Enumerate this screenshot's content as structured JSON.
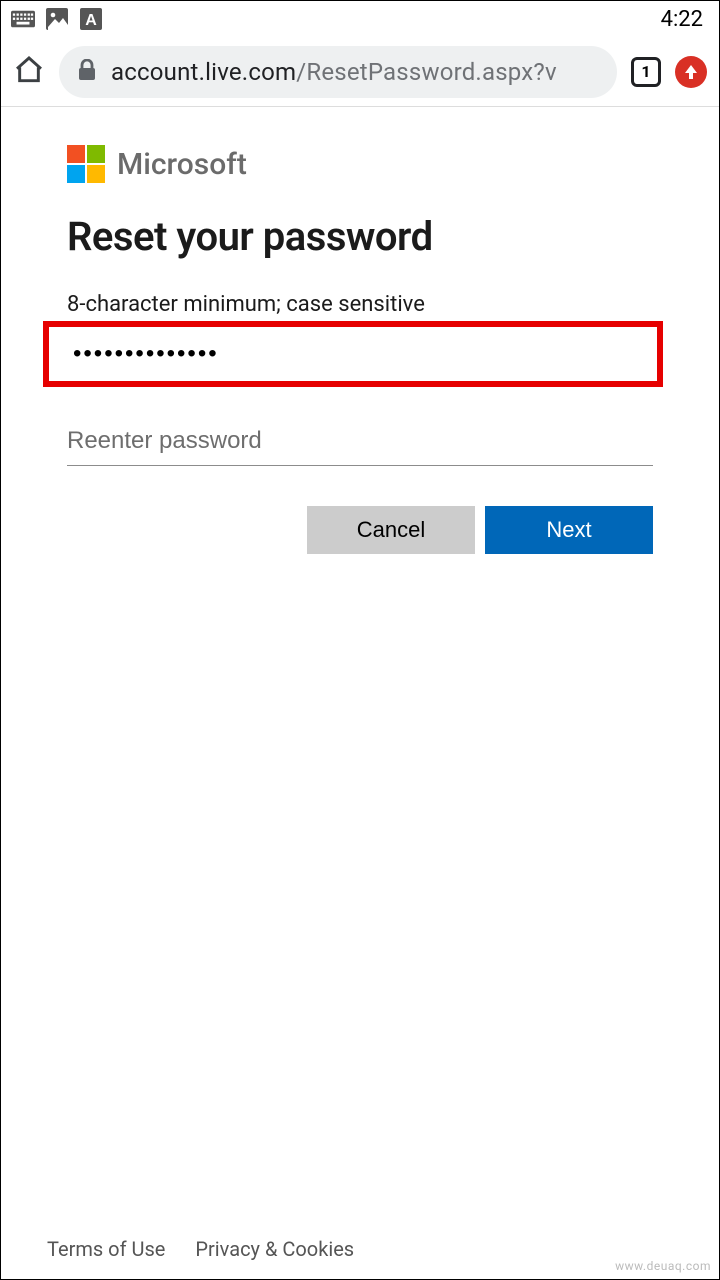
{
  "status_bar": {
    "time": "4:22"
  },
  "browser": {
    "tab_count": "1",
    "address_domain": "account.live.com",
    "address_path": "/ResetPassword.aspx?v"
  },
  "header": {
    "brand": "Microsoft"
  },
  "main": {
    "title": "Reset your password",
    "hint": "8-character minimum; case sensitive",
    "password_value": "••••••••••••••",
    "reenter_placeholder": "Reenter password"
  },
  "buttons": {
    "cancel": "Cancel",
    "next": "Next"
  },
  "footer": {
    "terms": "Terms of Use",
    "privacy": "Privacy & Cookies"
  },
  "watermark": "www.deuaq.com"
}
